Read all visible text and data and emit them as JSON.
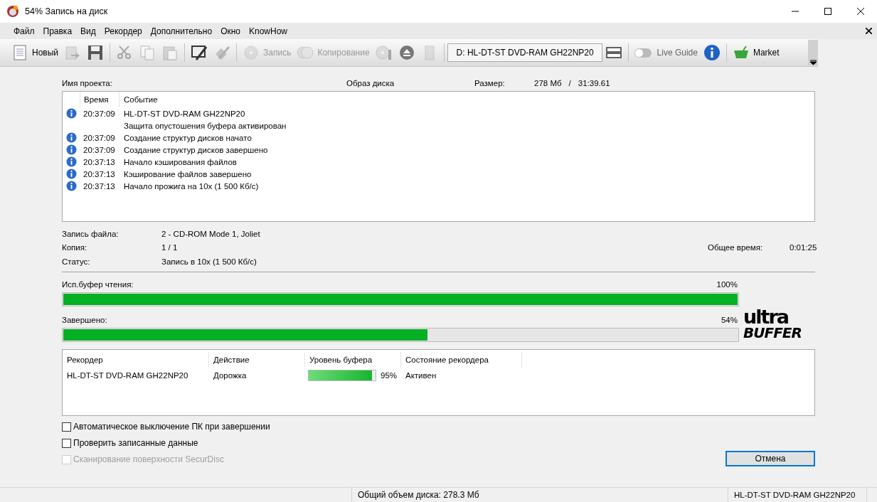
{
  "window": {
    "title": "54% Запись на диск"
  },
  "menu": [
    {
      "label": "Файл"
    },
    {
      "label": "Правка"
    },
    {
      "label": "Вид"
    },
    {
      "label": "Рекордер"
    },
    {
      "label": "Дополнительно"
    },
    {
      "label": "Окно"
    },
    {
      "label": "KnowHow"
    }
  ],
  "toolbar": [
    {
      "kind": "labeled",
      "label": "Новый",
      "disabled": false
    },
    {
      "kind": "button",
      "disabled": true
    },
    {
      "kind": "button",
      "disabled": false
    },
    {
      "kind": "separator"
    },
    {
      "kind": "button",
      "disabled": true
    },
    {
      "kind": "button",
      "disabled": true
    },
    {
      "kind": "button",
      "disabled": true
    },
    {
      "kind": "separator"
    },
    {
      "kind": "button",
      "disabled": false
    },
    {
      "kind": "button",
      "disabled": true
    },
    {
      "kind": "separator"
    },
    {
      "kind": "labeled",
      "label": "Запись",
      "disabled": true
    },
    {
      "kind": "labeled",
      "label": "Копирование",
      "disabled": true
    },
    {
      "kind": "button",
      "disabled": true
    },
    {
      "kind": "button",
      "disabled": false
    },
    {
      "kind": "button",
      "disabled": true
    },
    {
      "kind": "separator"
    },
    {
      "kind": "combo",
      "value": "D: HL-DT-ST DVD-RAM GH22NP20"
    },
    {
      "kind": "button",
      "disabled": false
    },
    {
      "kind": "separator"
    },
    {
      "kind": "toggle",
      "label": "Live Guide",
      "on": false
    },
    {
      "kind": "button",
      "disabled": false
    },
    {
      "kind": "separator"
    },
    {
      "kind": "labeled",
      "label": "Market",
      "disabled": false
    }
  ],
  "header": {
    "project_label": "Имя проекта:",
    "project_type": "Образ диска",
    "size_label": "Размер:",
    "size": "278 Мб",
    "separator": "/",
    "duration": "31:39.61"
  },
  "log": {
    "columns": [
      "Время",
      "Событие"
    ],
    "rows": [
      {
        "kind": "info",
        "time": "20:37:09",
        "event": "HL-DT-ST DVD-RAM GH22NP20"
      },
      {
        "kind": "continuation",
        "event": "Защита опустошения буфера активирован"
      },
      {
        "kind": "info",
        "time": "20:37:09",
        "event": "Создание структур дисков начато"
      },
      {
        "kind": "info",
        "time": "20:37:09",
        "event": "Создание структур дисков завершено"
      },
      {
        "kind": "info",
        "time": "20:37:13",
        "event": "Начало кэширования файлов"
      },
      {
        "kind": "info",
        "time": "20:37:13",
        "event": "Кэширование файлов завершено"
      },
      {
        "kind": "info",
        "time": "20:37:13",
        "event": "Начало прожига на 10x (1 500 Кб/с)"
      }
    ]
  },
  "details": [
    {
      "label": "Запись файла:",
      "value": "2 - CD-ROM Mode 1, Joliet"
    },
    {
      "label": "Копия:",
      "value": "1 / 1",
      "extra_label": "Общее время:",
      "extra_value": "0:01:25"
    },
    {
      "label": "Статус:",
      "value": "Запись в 10x (1 500 Кб/с)"
    }
  ],
  "progress": [
    {
      "label": "Исп.буфер чтения:",
      "reading": "100%",
      "level": 1.0
    },
    {
      "label": "Завершено:",
      "reading": "54%",
      "level": 0.54
    }
  ],
  "logo": [
    "ultra",
    "BUFFER"
  ],
  "recorders": {
    "columns": [
      "Рекордер",
      "Действие",
      "Уровень буфера",
      "Состояние рекордера"
    ],
    "rows": [
      {
        "recorder": "HL-DT-ST DVD-RAM GH22NP20",
        "action": "Дорожка",
        "level": 0.95,
        "reading": "95%",
        "state": "Активен"
      }
    ]
  },
  "options": [
    {
      "label": "Автоматическое выключение ПК при завершении",
      "checked": false,
      "disabled": false
    },
    {
      "label": "Проверить записанные данные",
      "checked": false,
      "disabled": false
    },
    {
      "label": "Сканирование поверхности SecurDisc",
      "checked": false,
      "disabled": true
    }
  ],
  "cancel_button": "Отмена",
  "status_bar": {
    "total": "Общий объем диска: 278.3 Мб",
    "drive": "HL-DT-ST DVD-RAM GH22NP20"
  }
}
